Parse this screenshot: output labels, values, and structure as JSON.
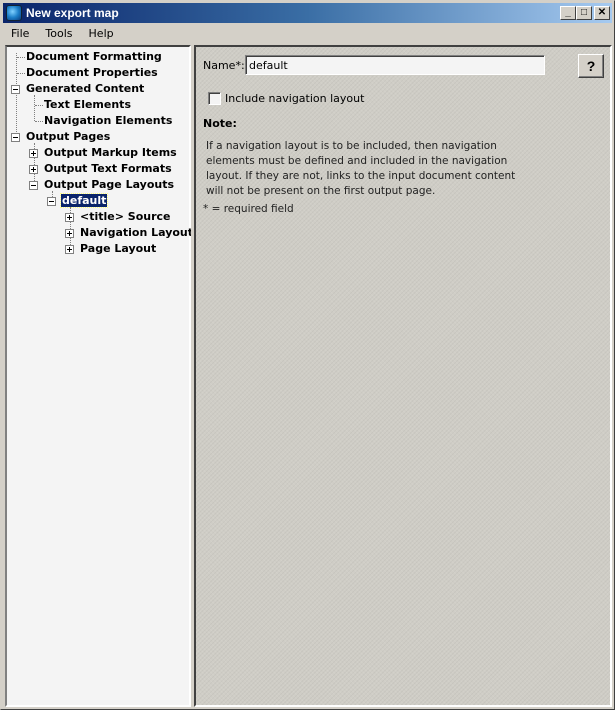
{
  "window": {
    "title": "New export map",
    "controls": {
      "minimize": "_",
      "maximize": "□",
      "close": "✕"
    }
  },
  "menu": [
    {
      "label": "File"
    },
    {
      "label": "Tools"
    },
    {
      "label": "Help"
    }
  ],
  "tree": {
    "nodes": [
      {
        "label": "Document Formatting",
        "level": 0,
        "expander": "none"
      },
      {
        "label": "Document Properties",
        "level": 0,
        "expander": "none"
      },
      {
        "label": "Generated Content",
        "level": 0,
        "expander": "minus"
      },
      {
        "label": "Text Elements",
        "level": 1,
        "expander": "none"
      },
      {
        "label": "Navigation Elements",
        "level": 1,
        "expander": "none"
      },
      {
        "label": "Output Pages",
        "level": 0,
        "expander": "minus"
      },
      {
        "label": "Output Markup Items",
        "level": 1,
        "expander": "plus"
      },
      {
        "label": "Output Text Formats",
        "level": 1,
        "expander": "plus"
      },
      {
        "label": "Output Page Layouts",
        "level": 1,
        "expander": "minus"
      },
      {
        "label": "default",
        "level": 2,
        "expander": "minus",
        "selected": true
      },
      {
        "label": "<title> Source",
        "level": 3,
        "expander": "plus"
      },
      {
        "label": "Navigation Layout",
        "level": 3,
        "expander": "plus"
      },
      {
        "label": "Page Layout",
        "level": 3,
        "expander": "plus"
      }
    ]
  },
  "form": {
    "name_label": "Name*:",
    "name_value": "default",
    "help_label": "?",
    "include_nav_label": "Include navigation layout",
    "include_nav_checked": false,
    "note_title": "Note:",
    "note_text": "If a navigation layout is to be included, then navigation elements must be defined and included in the navigation layout. If they are not, links to the input document content will not be present on the first output page.",
    "required_text": "* = required field"
  }
}
